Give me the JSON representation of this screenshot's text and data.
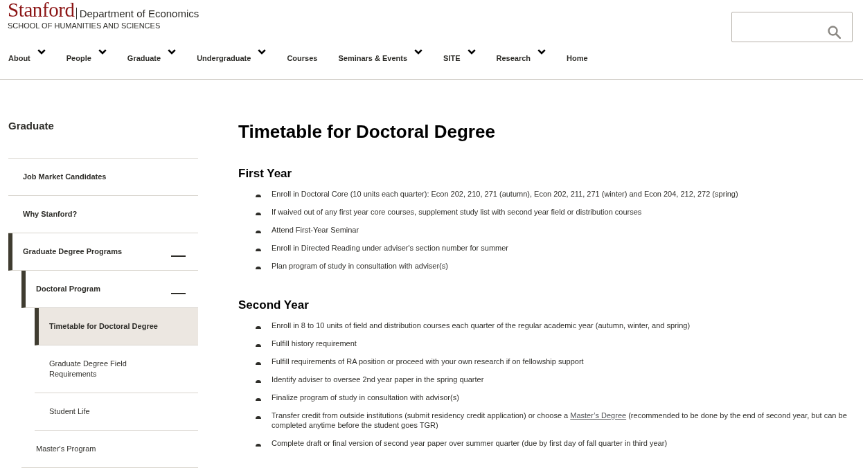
{
  "header": {
    "logo": "Stanford",
    "department": "Department of Economics",
    "school": "SCHOOL OF HUMANITIES AND SCIENCES"
  },
  "nav": [
    {
      "label": "About",
      "dropdown": true
    },
    {
      "label": "People",
      "dropdown": true
    },
    {
      "label": "Graduate",
      "dropdown": true
    },
    {
      "label": "Undergraduate",
      "dropdown": true
    },
    {
      "label": "Courses",
      "dropdown": false
    },
    {
      "label": "Seminars & Events",
      "dropdown": true
    },
    {
      "label": "SITE",
      "dropdown": true
    },
    {
      "label": "Research",
      "dropdown": true
    },
    {
      "label": "Home",
      "dropdown": false
    }
  ],
  "sidebar": {
    "title": "Graduate",
    "items": [
      {
        "label": "Job Market Candidates",
        "selected": false
      },
      {
        "label": "Why Stanford?",
        "selected": false
      },
      {
        "label": "Graduate Degree Programs",
        "selected": false,
        "expanded": true,
        "children": [
          {
            "label": "Doctoral Program",
            "selected": false,
            "expanded": true,
            "children": [
              {
                "label": "Timetable for Doctoral Degree",
                "selected": true
              },
              {
                "label": "Graduate Degree Field Requirements",
                "selected": false
              },
              {
                "label": "Student Life",
                "selected": false
              }
            ]
          },
          {
            "label": "Master's Program",
            "selected": false
          }
        ]
      }
    ]
  },
  "main": {
    "title": "Timetable for Doctoral Degree",
    "sections": [
      {
        "heading": "First Year",
        "items": [
          {
            "segments": [
              {
                "kind": "text",
                "text": "Enroll in Doctoral Core (10 units each quarter): Econ 202, 210, 271 (autumn), Econ 202, 211, 271 (winter) and Econ 204, 212, 272 (spring)"
              }
            ]
          },
          {
            "segments": [
              {
                "kind": "text",
                "text": "If waived out of any first year core courses, supplement study list with second year field or distribution courses"
              }
            ]
          },
          {
            "segments": [
              {
                "kind": "text",
                "text": "Attend First-Year Seminar"
              }
            ]
          },
          {
            "segments": [
              {
                "kind": "text",
                "text": "Enroll in Directed Reading under adviser's section number for summer"
              }
            ]
          },
          {
            "segments": [
              {
                "kind": "text",
                "text": "Plan program of study in consultation with adviser(s)"
              }
            ]
          }
        ]
      },
      {
        "heading": "Second Year",
        "items": [
          {
            "segments": [
              {
                "kind": "text",
                "text": "Enroll in 8 to 10 units of field and distribution courses each quarter of the regular academic year (autumn, winter, and spring)"
              }
            ]
          },
          {
            "segments": [
              {
                "kind": "text",
                "text": "Fulfill history requirement"
              }
            ]
          },
          {
            "segments": [
              {
                "kind": "text",
                "text": "Fulfill requirements of RA position or proceed with your own research if on fellowship support"
              }
            ]
          },
          {
            "segments": [
              {
                "kind": "text",
                "text": "Identify adviser to oversee 2nd year paper in the spring quarter"
              }
            ]
          },
          {
            "segments": [
              {
                "kind": "text",
                "text": "Finalize program of study in consultation with advisor(s)"
              }
            ]
          },
          {
            "segments": [
              {
                "kind": "text",
                "text": "Transfer credit from outside institutions (submit residency credit application) or choose a "
              },
              {
                "kind": "link",
                "text": "Master’s Degree"
              },
              {
                "kind": "text",
                "text": " (recommended to be done by the end of second year, but can be completed anytime before the student goes TGR)"
              }
            ]
          },
          {
            "segments": [
              {
                "kind": "text",
                "text": "Complete draft or final version of second year paper over summer quarter (due by first day of fall quarter in third year)"
              }
            ]
          }
        ]
      }
    ]
  }
}
